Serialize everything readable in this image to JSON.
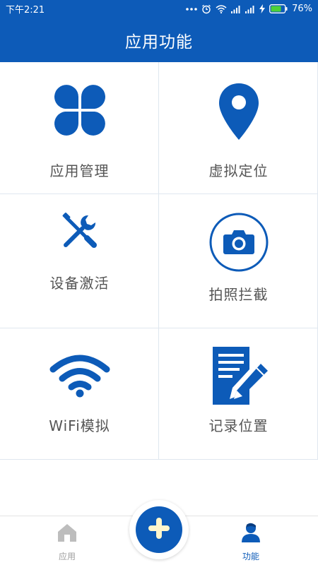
{
  "status_bar": {
    "time": "下午2:21",
    "battery_percent": "76%",
    "battery_level": 0.76,
    "icons": [
      "more-dots-icon",
      "alarm-icon",
      "wifi-icon",
      "signal-icon",
      "signal-icon",
      "charging-icon",
      "battery-icon"
    ]
  },
  "header": {
    "title": "应用功能"
  },
  "features": [
    {
      "label": "应用管理",
      "icon": "clover-icon"
    },
    {
      "label": "虚拟定位",
      "icon": "location-pin-icon"
    },
    {
      "label": "设备激活",
      "icon": "tools-icon"
    },
    {
      "label": "拍照拦截",
      "icon": "camera-icon"
    },
    {
      "label": "WiFi模拟",
      "icon": "wifi-icon"
    },
    {
      "label": "记录位置",
      "icon": "note-edit-icon"
    }
  ],
  "bottom_nav": {
    "home_label": "应用",
    "function_label": "功能",
    "add_icon": "plus-icon"
  },
  "colors": {
    "primary": "#0d5bb8",
    "active_tab": "#0d5bb8",
    "inactive_tab": "#9e9e9e",
    "label_text": "#555555"
  }
}
